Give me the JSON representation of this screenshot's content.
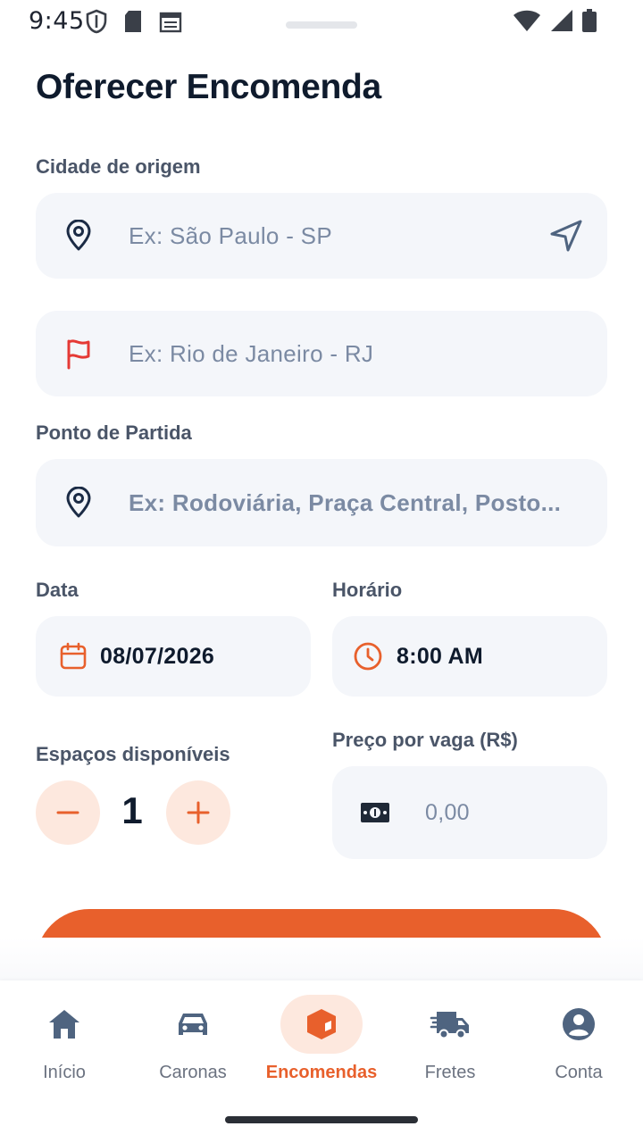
{
  "status_bar": {
    "time": "9:45"
  },
  "page": {
    "title": "Oferecer Encomenda"
  },
  "origin": {
    "label": "Cidade de origem",
    "placeholder": "Ex: São Paulo - SP",
    "lead_icon": "map-pin-icon",
    "trail_icon": "navigation-arrow-icon"
  },
  "destination": {
    "placeholder": "Ex: Rio de Janeiro - RJ",
    "lead_icon": "flag-icon"
  },
  "departure_point": {
    "label": "Ponto de Partida",
    "placeholder": "Ex: Rodoviária, Praça Central, Posto..."
  },
  "date": {
    "label": "Data",
    "value": "08/07/2026"
  },
  "time": {
    "label": "Horário",
    "value": "8:00 AM"
  },
  "spaces": {
    "label": "Espaços disponíveis",
    "value": "1"
  },
  "price": {
    "label": "Preço por vaga (R$)",
    "placeholder": "0,00"
  },
  "colors": {
    "accent": "#e8602c",
    "accent_light": "#fde8de",
    "field_bg": "#f4f6fa",
    "text_dark": "#0f1b2d",
    "placeholder": "#7b8aa3"
  },
  "bottom_nav": {
    "items": [
      {
        "label": "Início",
        "icon": "home-icon"
      },
      {
        "label": "Caronas",
        "icon": "car-icon"
      },
      {
        "label": "Encomendas",
        "icon": "package-icon",
        "active": true
      },
      {
        "label": "Fretes",
        "icon": "truck-icon"
      },
      {
        "label": "Conta",
        "icon": "account-icon"
      }
    ]
  }
}
